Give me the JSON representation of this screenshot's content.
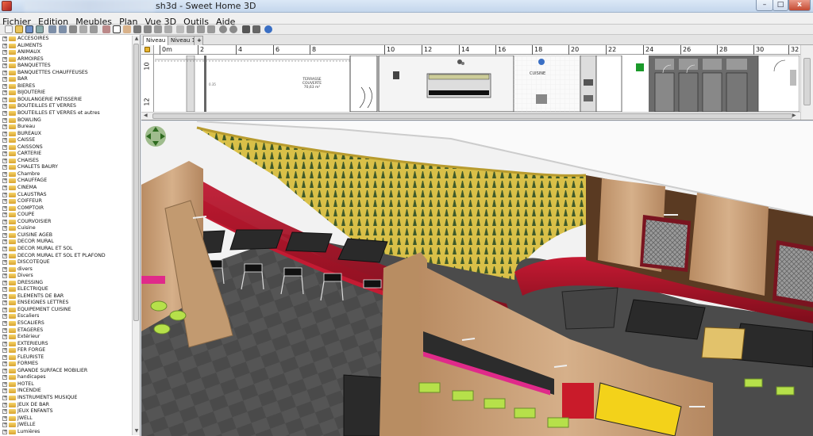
{
  "window": {
    "title": "sh3d - Sweet Home 3D",
    "min_label": "–",
    "max_label": "□",
    "close_label": "x"
  },
  "menu": [
    "Fichier",
    "Edition",
    "Meubles",
    "Plan",
    "Vue 3D",
    "Outils",
    "Aide"
  ],
  "catalog": {
    "categories": [
      "ACCESOIRES",
      "ALIMENTS",
      "ANIMAUX",
      "ARMOIRES",
      "BANQUETTES",
      "BANQUETTES CHAUFFEUSES",
      "BAR",
      "BIERES",
      "BIJOUTERIE",
      "BOULANGERIE PATISSERIE",
      "BOUTEILLES ET VERRES",
      "BOUTEILLES ET VERRES et autres",
      "BOWLING",
      "Bureau",
      "BUREAUX",
      "CAISSE",
      "CAISSONS",
      "CARTERIE",
      "CHAISES",
      "CHALETS BAURY",
      "Chambre",
      "CHAUFFAGE",
      "CINEMA",
      "CLAUSTRAS",
      "COIFFEUR",
      "COMPTOIR",
      "COUPE",
      "COURVOISIER",
      "Cuisine",
      "CUISINE AGEB",
      "DECOR MURAL",
      "DECOR MURAL ET SOL",
      "DECOR MURAL ET SOL ET PLAFOND",
      "DISCOTEQUE",
      "divers",
      "Divers",
      "DRESSING",
      "ELECTRIQUE",
      "ELEMENTS DE BAR",
      "ENSEIGNES LETTRES",
      "EQUIPEMENT CUISINE",
      "Escaliers",
      "ESCALIERS",
      "ETAGERES",
      "Extérieur",
      "EXTERIEURS",
      "FER FORGE",
      "FLEURISTE",
      "FORMES",
      "GRANDE SURFACE MOBILIER",
      "handicapes",
      "HOTEL",
      "INCENDIE",
      "INSTRUMENTS MUSIQUE",
      "JEUX DE BAR",
      "JEUX ENFANTS",
      "JWELL",
      "JWELLE",
      "Lumières"
    ]
  },
  "plan": {
    "tabs": [
      "Niveau 0",
      "Niveau 1"
    ],
    "add_tab_label": "+",
    "ruler_h": [
      "0m",
      "2",
      "4",
      "6",
      "8",
      "10",
      "12",
      "14",
      "16",
      "18",
      "20",
      "22",
      "24",
      "26",
      "28",
      "30",
      "32"
    ],
    "ruler_v": [
      "10",
      "12"
    ],
    "room_labels": {
      "terrasse": "TERRASSE\nCOUVERTE\n70,63 m²",
      "cuisine": "CUISINE",
      "small": "0.35"
    }
  },
  "colors": {
    "title_bar": "#c4d6ec",
    "bench_red": "#b0142a",
    "wood": "#c9a27a",
    "yellow_wall": "#e3c93a",
    "lime": "#b6e04a",
    "pink": "#e02a8a"
  },
  "icons": [
    "new-icon",
    "open-icon",
    "save-icon",
    "cut-icon",
    "copy-icon",
    "paste-icon",
    "undo-icon",
    "redo-icon",
    "select-icon",
    "pan-icon",
    "create-walls-icon",
    "create-rooms-icon",
    "create-dimensions-icon",
    "add-text-icon",
    "zoom-in-icon",
    "zoom-out-icon",
    "photo-icon",
    "video-icon",
    "help-icon"
  ]
}
